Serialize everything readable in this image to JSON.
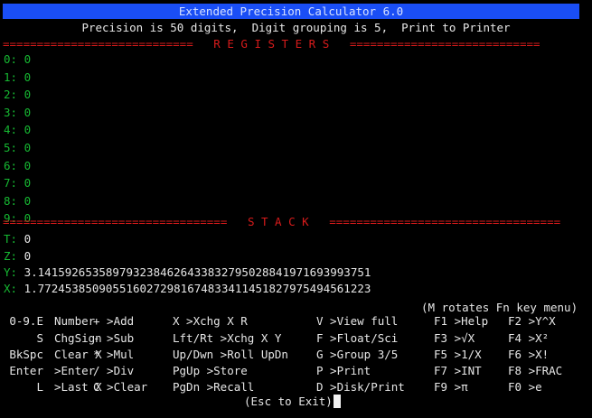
{
  "window": {
    "title": "Extended Precision Calculator 6.0",
    "status": "Precision is 50 digits,  Digit grouping is 5,  Print to Printer"
  },
  "registers": {
    "header": "R E G I S T E R S",
    "header_left": "============================",
    "header_right": "============================",
    "items": [
      {
        "label": "0:",
        "value": "0"
      },
      {
        "label": "1:",
        "value": "0"
      },
      {
        "label": "2:",
        "value": "0"
      },
      {
        "label": "3:",
        "value": "0"
      },
      {
        "label": "4:",
        "value": "0"
      },
      {
        "label": "5:",
        "value": "0"
      },
      {
        "label": "6:",
        "value": "0"
      },
      {
        "label": "7:",
        "value": "0"
      },
      {
        "label": "8:",
        "value": "0"
      },
      {
        "label": "9:",
        "value": "0"
      }
    ]
  },
  "stack": {
    "header": "S T A C K",
    "header_left": "=================================",
    "header_right": "==================================",
    "items": [
      {
        "label": "T:",
        "value": "0"
      },
      {
        "label": "Z:",
        "value": "0"
      },
      {
        "label": "Y:",
        "value": "3.1415926535897932384626433832795028841971693993751"
      },
      {
        "label": "X:",
        "value": "1.7724538509055160272981674833411451827975494561223"
      }
    ]
  },
  "menu": {
    "hint": "(M rotates Fn key menu)",
    "rows": [
      [
        "0-9.E",
        "Number",
        "+ >Add",
        "X >Xchg X R",
        "V >View full",
        "F1 >Help",
        "F2 >Y^X"
      ],
      [
        "S",
        "ChgSign",
        "- >Sub",
        "Lft/Rt >Xchg X Y",
        "F >Float/Sci",
        "F3 >√X",
        "F4 >X²"
      ],
      [
        "BkSpc",
        "Clear X",
        "* >Mul",
        "Up/Dwn >Roll UpDn",
        "G >Group 3/5",
        "F5 >1/X",
        "F6 >X!"
      ],
      [
        "Enter",
        ">Enter",
        "/ >Div",
        "PgUp >Store",
        "P >Print",
        "F7 >INT",
        "F8 >FRAC"
      ],
      [
        "L",
        ">Last X",
        "C >Clear",
        "PgDn >Recall",
        "D >Disk/Print",
        "F9 >π",
        "F0 >e"
      ]
    ],
    "exit": "(Esc to Exit)"
  }
}
